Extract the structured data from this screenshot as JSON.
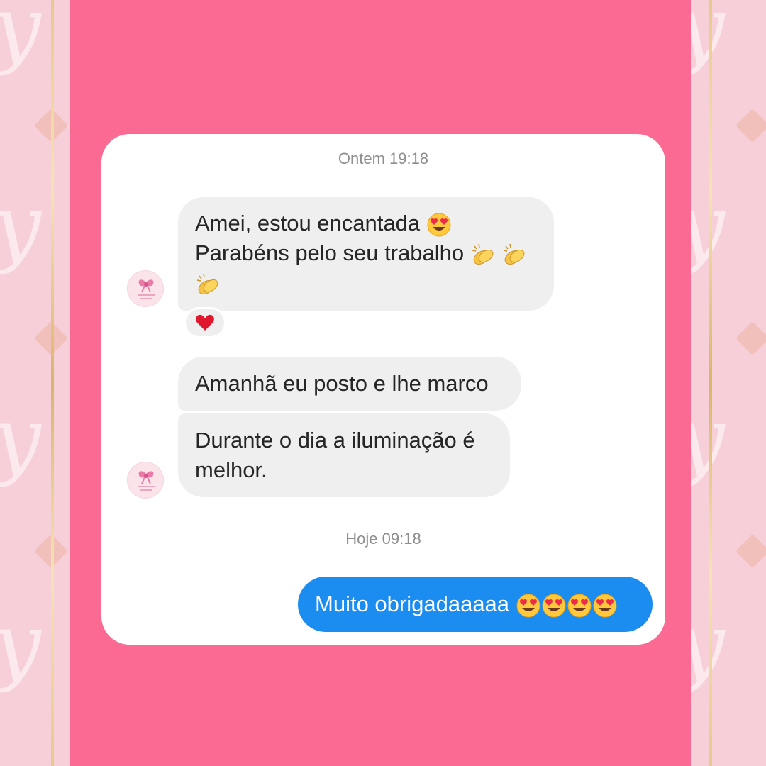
{
  "conversation": {
    "timestamp_1": "Ontem 19:18",
    "timestamp_2": "Hoje 09:18",
    "received": [
      {
        "lines": [
          "Amei, estou encantada",
          "Parabéns pelo seu trabalho"
        ],
        "emojis": [
          "heart-eyes",
          "clapping-hands",
          "clapping-hands",
          "clapping-hands"
        ],
        "reaction": "red-heart"
      },
      {
        "text": "Amanhã eu posto e lhe marco"
      },
      {
        "lines": [
          "Durante o dia a iluminação é",
          "melhor."
        ]
      }
    ],
    "sent": [
      {
        "text": "Muito obrigadaaaaa",
        "emojis": [
          "heart-eyes",
          "heart-eyes",
          "heart-eyes",
          "heart-eyes"
        ]
      }
    ]
  },
  "colors": {
    "panel": "#fb6a93",
    "sent_bubble": "#1b8cf0",
    "received_bubble": "#efefef",
    "side_background": "#f7cfd8",
    "gold_border": "#e8c98a"
  }
}
